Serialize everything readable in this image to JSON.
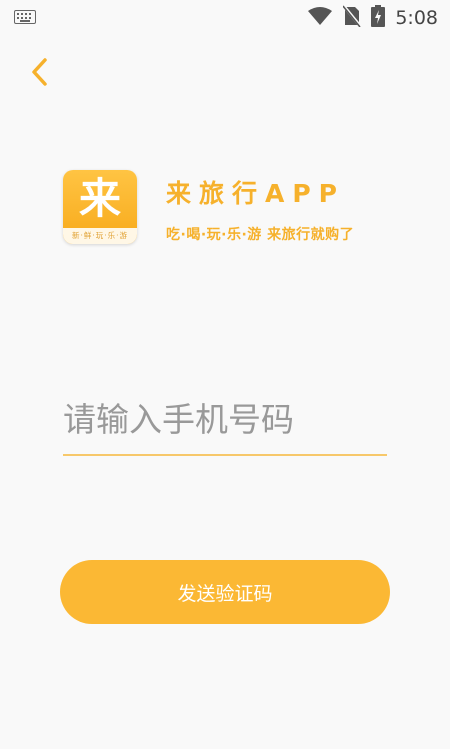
{
  "status_bar": {
    "time": "5:08",
    "icons": [
      "keyboard-icon",
      "wifi-icon",
      "no-sim-icon",
      "battery-charging-icon"
    ]
  },
  "header": {
    "back_icon": "chevron-left-icon"
  },
  "brand": {
    "logo_char": "来",
    "logo_subtext": "新·鲜·玩·乐·游",
    "title": "来旅行APP",
    "slogan": "吃·喝·玩·乐·游 来旅行就购了"
  },
  "form": {
    "phone_placeholder": "请输入手机号码",
    "phone_value": "",
    "send_button_label": "发送验证码"
  },
  "colors": {
    "accent": "#f6b12c",
    "button": "#fbb834",
    "background": "#f9f9f9"
  }
}
